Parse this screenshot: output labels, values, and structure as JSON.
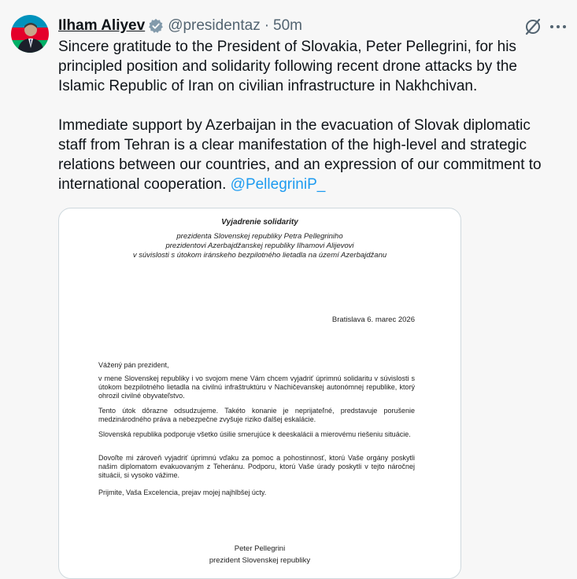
{
  "author": {
    "display_name": "Ilham Aliyev",
    "handle": "@presidentaz",
    "separator": "·",
    "time": "50m"
  },
  "icons": {
    "verified": "verified-badge-icon",
    "grok": "grok-icon",
    "more": "more-icon",
    "avatar_flag_colors": [
      "#0092bc",
      "#e4002b",
      "#00af66"
    ]
  },
  "post": {
    "paragraph1": "Sincere gratitude to the President of Slovakia, Peter Pellegrini, for his principled position and solidarity following recent drone attacks by the Islamic Republic of Iran on civilian infrastructure in Nakhchivan.",
    "paragraph2": "Immediate support by Azerbaijan in the evacuation of Slovak diplomatic staff from Tehran is a clear manifestation of the high-level and strategic relations between our countries, and an expression of our commitment to international cooperation. ",
    "mention": "@PellegriniP_"
  },
  "document": {
    "title": "Vyjadrenie solidarity",
    "subtitle_lines": [
      "prezidenta Slovenskej republiky Petra Pellegriniho",
      "prezidentovi Azerbajdžanskej republiky Ilhamovi Alijevovi",
      "v súvislosti s útokom iránskeho bezpilotného lietadla na území Azerbajdžanu"
    ],
    "date": "Bratislava 6. marec 2026",
    "salutation": "Vážený pán prezident,",
    "paragraphs": [
      "v mene Slovenskej republiky i vo svojom mene Vám chcem vyjadriť úprimnú solidaritu v súvislosti s útokom bezpilotného lietadla na civilnú infraštruktúru v Nachičevanskej autonómnej republike, ktorý ohrozil civilné obyvateľstvo.",
      "Tento útok dôrazne odsudzujeme. Takéto konanie je neprijateľné, predstavuje porušenie medzinárodného práva a nebezpečne zvyšuje riziko ďalšej eskalácie.",
      "Slovenská republika podporuje všetko úsilie smerujúce k deeskalácii a mierovému riešeniu situácie.",
      "Dovoľte mi zároveň vyjadriť úprimnú vďaku za pomoc a pohostinnosť, ktorú Vaše orgány poskytli našim diplomatom evakuovaným z Teheránu. Podporu, ktorú Vaše úrady poskytli v tejto náročnej situácii, si vysoko vážime.",
      "Prijmite, Vaša Excelencia, prejav mojej najhlbšej úcty."
    ],
    "signature_name": "Peter Pellegrini",
    "signature_title": "prezident Slovenskej republiky"
  }
}
